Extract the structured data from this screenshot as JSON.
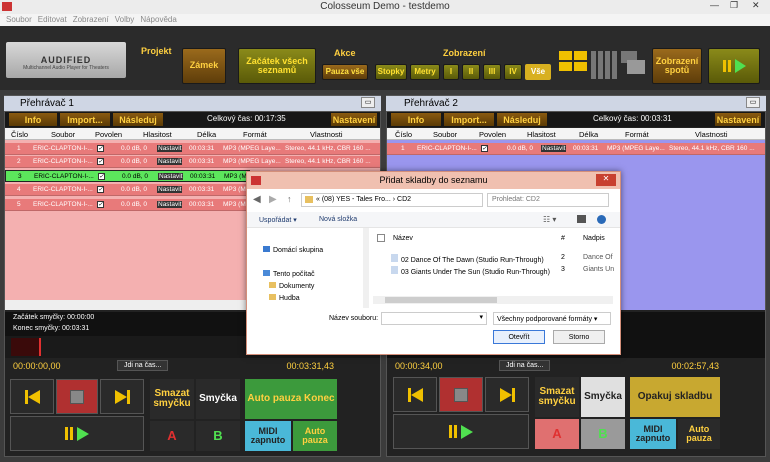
{
  "window": {
    "title": "Colosseum Demo - testdemo",
    "min": "—",
    "max": "❐",
    "close": "✕"
  },
  "menu": [
    "Soubor",
    "Editovat",
    "Zobrazení",
    "Volby",
    "Nápověda"
  ],
  "logo": {
    "brand": "AUDIFIED",
    "tagline": "Multichannel Audio Player for Theaters"
  },
  "top": {
    "projekt": "Projekt",
    "zamek": "Zámek",
    "zacatek": "Začátek všech seznamů",
    "akce": "Akce",
    "pauza_vse": "Pauza vše",
    "zobrazeni": "Zobrazení",
    "stopky": "Stopky",
    "metry": "Metry",
    "v1": "I",
    "v2": "II",
    "v3": "III",
    "v4": "IV",
    "vse": "Vše",
    "zobrazeni_spotu": "Zobrazení spotů"
  },
  "p1": {
    "title": "Přehrávač 1",
    "info": "Info",
    "import": "Import...",
    "nasleduj": "Následuj",
    "celkovy": "Celkový čas: 00:17:35",
    "nastaveni": "Nastavení",
    "cols": [
      "Číslo",
      "Soubor",
      "Povolen",
      "Hlasitost",
      "Délka",
      "Formát",
      "Vlastnosti"
    ],
    "rows": [
      {
        "n": "1",
        "file": "ERIC-CLAPTON-I-...",
        "vol": "0.0 dB, 0",
        "nas": "Nastavit",
        "len": "00:03:31",
        "fmt": "MP3 (MPEG Laye...",
        "prop": "Stereo, 44.1 kHz, CBR 160 ..."
      },
      {
        "n": "2",
        "file": "ERIC-CLAPTON-I-...",
        "vol": "0.0 dB, 0",
        "nas": "Nastavit",
        "len": "00:03:31",
        "fmt": "MP3 (MPEG Laye...",
        "prop": "Stereo, 44.1 kHz, CBR 160 ..."
      },
      {
        "n": "3",
        "file": "ERIC-CLAPTON-I-...",
        "vol": "0.0 dB, 0",
        "nas": "Nastavit",
        "len": "00:03:31",
        "fmt": "MP3 (M",
        "prop": ""
      },
      {
        "n": "4",
        "file": "ERIC-CLAPTON-I-...",
        "vol": "0.0 dB, 0",
        "nas": "Nastavit",
        "len": "00:03:31",
        "fmt": "MP3 (M",
        "prop": ""
      },
      {
        "n": "5",
        "file": "ERIC-CLAPTON-I-...",
        "vol": "0.0 dB, 0",
        "nas": "Nastavit",
        "len": "00:03:31",
        "fmt": "MP3 (M",
        "prop": ""
      }
    ],
    "loop_start": "Začátek smyčky: 00:00:00",
    "loop_end": "Konec smyčky: 00:03:31",
    "time_left": "00:00:00,00",
    "jdi": "Jdi na čas...",
    "time_right": "00:03:31,43",
    "smazat": "Smazat smyčku",
    "smycka": "Smyčka",
    "autopauza": "Auto pauza Konec",
    "a": "A",
    "b": "B",
    "midi": "MIDI zapnuto",
    "auto_pauza": "Auto pauza"
  },
  "p2": {
    "title": "Přehrávač 2",
    "info": "Info",
    "import": "Import...",
    "nasleduj": "Následuj",
    "celkovy": "Celkový čas: 00:03:31",
    "nastaveni": "Nastavení",
    "cols": [
      "Číslo",
      "Soubor",
      "Povolen",
      "Hlasitost",
      "Délka",
      "Formát",
      "Vlastnosti"
    ],
    "rows": [
      {
        "n": "1",
        "file": "ERIC-CLAPTON-I-...",
        "vol": "0.0 dB, 0",
        "nas": "Nastavit",
        "len": "00:03:31",
        "fmt": "MP3 (MPEG Laye...",
        "prop": "Stereo, 44.1 kHz, CBR 160 ..."
      }
    ],
    "time_left": "00:00:34,00",
    "jdi": "Jdi na čas...",
    "time_right": "00:02:57,43",
    "smazat": "Smazat smyčku",
    "smycka": "Smyčka",
    "opakuj": "Opakuj skladbu",
    "a": "A",
    "b": "B",
    "midi": "MIDI zapnuto",
    "auto_pauza": "Auto pauza"
  },
  "dialog": {
    "title": "Přidat skladby do seznamu",
    "path": "« (08) YES - Tales Fro... › CD2",
    "search": "Prohledat: CD2",
    "usporadat": "Uspořádat ▾",
    "nova": "Nová složka",
    "tree": [
      "Domácí skupina",
      "Tento počítač",
      "Dokumenty",
      "Hudba"
    ],
    "col_name": "Název",
    "col_num": "#",
    "col_title": "Nadpis",
    "files": [
      {
        "name": "02 Dance Of The Dawn (Studio Run-Through)",
        "num": "2",
        "title": "Dance Of"
      },
      {
        "name": "03 Giants Under The Sun (Studio Run-Through)",
        "num": "3",
        "title": "Giants Un"
      }
    ],
    "filename_label": "Název souboru:",
    "filter": "Všechny podporované formáty",
    "open": "Otevřít",
    "cancel": "Storno"
  }
}
